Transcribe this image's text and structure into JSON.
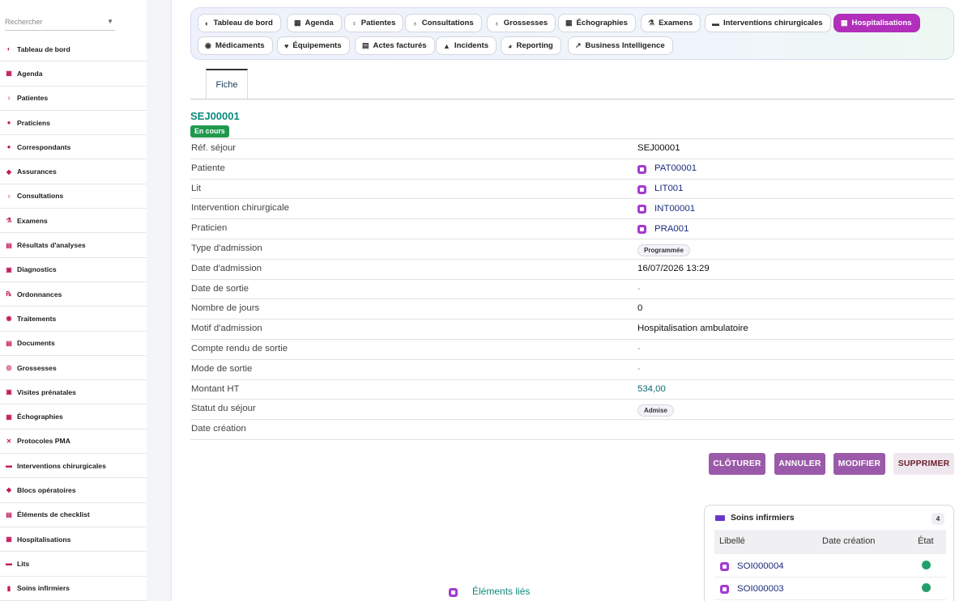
{
  "sidebar": {
    "search_placeholder": "Rechercher",
    "items": [
      {
        "label": "Tableau de bord",
        "icon": "gauge-icon",
        "glyph": "◐"
      },
      {
        "label": "Agenda",
        "icon": "calendar-icon",
        "glyph": "▦"
      },
      {
        "label": "Patientes",
        "icon": "female-icon",
        "glyph": "♀"
      },
      {
        "label": "Praticiens",
        "icon": "doctor-icon",
        "glyph": "●"
      },
      {
        "label": "Correspondants",
        "icon": "contact-icon",
        "glyph": "●"
      },
      {
        "label": "Assurances",
        "icon": "shield-icon",
        "glyph": "◆"
      },
      {
        "label": "Consultations",
        "icon": "stethoscope-icon",
        "glyph": "♁"
      },
      {
        "label": "Examens",
        "icon": "microscope-icon",
        "glyph": "⚗"
      },
      {
        "label": "Résultats d'analyses",
        "icon": "lab-results-icon",
        "glyph": "▤"
      },
      {
        "label": "Diagnostics",
        "icon": "diagnostic-icon",
        "glyph": "▣"
      },
      {
        "label": "Ordonnances",
        "icon": "prescription-icon",
        "glyph": "℞"
      },
      {
        "label": "Traitements",
        "icon": "pills-icon",
        "glyph": "◉"
      },
      {
        "label": "Documents",
        "icon": "document-icon",
        "glyph": "▤"
      },
      {
        "label": "Grossesses",
        "icon": "pregnancy-icon",
        "glyph": "◎"
      },
      {
        "label": "Visites prénatales",
        "icon": "prenatal-icon",
        "glyph": "▣"
      },
      {
        "label": "Échographies",
        "icon": "ultrasound-icon",
        "glyph": "▦"
      },
      {
        "label": "Protocoles PMA",
        "icon": "dna-icon",
        "glyph": "✕"
      },
      {
        "label": "Interventions chirurgicales",
        "icon": "bed-icon",
        "glyph": "▬"
      },
      {
        "label": "Blocs opératoires",
        "icon": "operating-room-icon",
        "glyph": "◆"
      },
      {
        "label": "Éléments de checklist",
        "icon": "checklist-icon",
        "glyph": "▤"
      },
      {
        "label": "Hospitalisations",
        "icon": "hospital-icon",
        "glyph": "▦"
      },
      {
        "label": "Lits",
        "icon": "bed-icon",
        "glyph": "▬"
      },
      {
        "label": "Soins infirmiers",
        "icon": "nursing-icon",
        "glyph": "▮"
      }
    ]
  },
  "tabs": [
    {
      "label": "Tableau de bord",
      "icon": "gauge-icon",
      "glyph": "◐"
    },
    {
      "label": "Agenda",
      "icon": "calendar-icon",
      "glyph": "▦"
    },
    {
      "label": "Patientes",
      "icon": "female-icon",
      "glyph": "♀"
    },
    {
      "label": "Consultations",
      "icon": "stethoscope-icon",
      "glyph": "♁"
    },
    {
      "label": "Grossesses",
      "icon": "pregnancy-icon",
      "glyph": "♁"
    },
    {
      "label": "Échographies",
      "icon": "ultrasound-icon",
      "glyph": "▦"
    },
    {
      "label": "Examens",
      "icon": "microscope-icon",
      "glyph": "⚗"
    },
    {
      "label": "Interventions chirurgicales",
      "icon": "bed-icon",
      "glyph": "▬"
    },
    {
      "label": "Hospitalisations",
      "icon": "hospital-icon",
      "glyph": "▦"
    },
    {
      "label": "Médicaments",
      "icon": "pills-icon",
      "glyph": "◉"
    },
    {
      "label": "Équipements",
      "icon": "equipment-icon",
      "glyph": "♥"
    },
    {
      "label": "Actes facturés",
      "icon": "invoice-icon",
      "glyph": "▤"
    },
    {
      "label": "Incidents",
      "icon": "warning-icon",
      "glyph": "▲"
    },
    {
      "label": "Reporting",
      "icon": "pie-chart-icon",
      "glyph": "◕"
    },
    {
      "label": "Business Intelligence",
      "icon": "line-chart-icon",
      "glyph": "↗"
    }
  ],
  "active_tab": "Hospitalisations",
  "fiche_tab": "Fiche",
  "record": {
    "title": "SEJ00001",
    "status": "En cours",
    "fields": [
      {
        "label": "Réf. séjour",
        "value": "SEJ00001",
        "type": "text"
      },
      {
        "label": "Patiente",
        "value": "PAT00001",
        "type": "link"
      },
      {
        "label": "Lit",
        "value": "LIT001",
        "type": "link"
      },
      {
        "label": "Intervention chirurgicale",
        "value": "INT00001",
        "type": "link"
      },
      {
        "label": "Praticien",
        "value": "PRA001",
        "type": "link"
      },
      {
        "label": "Type d'admission",
        "value": "Programmée",
        "type": "chip"
      },
      {
        "label": "Date d'admission",
        "value": "16/07/2026 13:29",
        "type": "text"
      },
      {
        "label": "Date de sortie",
        "value": "-",
        "type": "dash"
      },
      {
        "label": "Nombre de jours",
        "value": "0",
        "type": "text"
      },
      {
        "label": "Motif d'admission",
        "value": "Hospitalisation ambulatoire",
        "type": "text"
      },
      {
        "label": "Compte rendu de sortie",
        "value": "-",
        "type": "dash"
      },
      {
        "label": "Mode de sortie",
        "value": "-",
        "type": "dash"
      },
      {
        "label": "Montant HT",
        "value": "534,00",
        "type": "money"
      },
      {
        "label": "Statut du séjour",
        "value": "Admise",
        "type": "chip"
      },
      {
        "label": "Date création",
        "value": "",
        "type": "text"
      }
    ]
  },
  "actions": {
    "close": "CLÔTURER",
    "cancel": "ANNULER",
    "edit": "MODIFIER",
    "delete": "SUPPRIMER"
  },
  "soins": {
    "title": "Soins infirmiers",
    "count": "4",
    "columns": [
      "Libellé",
      "Date création",
      "État"
    ],
    "rows": [
      {
        "code": "SOI000004",
        "date": "",
        "state": "green"
      },
      {
        "code": "SOI000003",
        "date": "",
        "state": "green"
      }
    ]
  },
  "related": {
    "label": "Éléments liés"
  },
  "colors": {
    "accent": "#b12fba",
    "teal": "#0b8a7c",
    "success": "#1f9a4d",
    "button": "#9b5aa9"
  }
}
